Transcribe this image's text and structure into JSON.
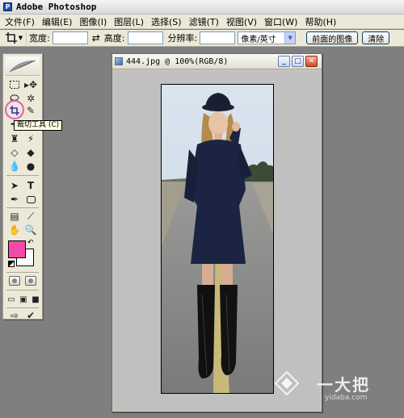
{
  "app": {
    "title": "Adobe Photoshop",
    "icon": "photoshop-icon"
  },
  "menu": [
    {
      "label": "文件(F)"
    },
    {
      "label": "编辑(E)"
    },
    {
      "label": "图像(I)"
    },
    {
      "label": "图层(L)"
    },
    {
      "label": "选择(S)"
    },
    {
      "label": "滤镜(T)"
    },
    {
      "label": "视图(V)"
    },
    {
      "label": "窗口(W)"
    },
    {
      "label": "帮助(H)"
    }
  ],
  "options": {
    "tool_icon": "crop-tool-icon",
    "width_label": "宽度:",
    "width_value": "",
    "height_label": "高度:",
    "height_value": "",
    "resolution_label": "分辨率:",
    "resolution_value": "",
    "unit_selected": "像素/英寸",
    "front_image_button": "前面的图像",
    "clear_button": "清除"
  },
  "tooltip": {
    "text": "裁切工具 (C)"
  },
  "colors": {
    "foreground": "#f24aa6",
    "background": "#ffffff",
    "highlight": "#e85bb5"
  },
  "document": {
    "title": "444.jpg @ 100%(RGB/8)",
    "buttons": [
      "minimize",
      "maximize",
      "close"
    ]
  },
  "watermark": {
    "text": "一大把",
    "url": "yidaba.com"
  }
}
